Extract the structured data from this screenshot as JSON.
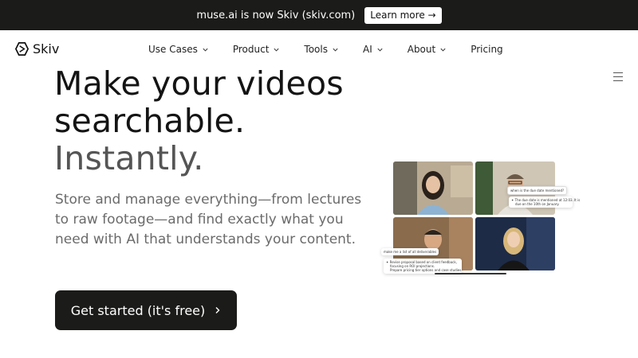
{
  "announcement": {
    "text": "muse.ai is now Skiv (skiv.com)",
    "button_label": "Learn more →"
  },
  "nav": {
    "logo_text": "Skiv",
    "items": [
      {
        "label": "Use Cases",
        "has_dropdown": true
      },
      {
        "label": "Product",
        "has_dropdown": true
      },
      {
        "label": "Tools",
        "has_dropdown": true
      },
      {
        "label": "AI",
        "has_dropdown": true
      },
      {
        "label": "About",
        "has_dropdown": true
      },
      {
        "label": "Pricing",
        "has_dropdown": false
      }
    ]
  },
  "hero": {
    "title_line1": "Make your videos",
    "title_line2": "searchable.",
    "title_line3": "Instantly.",
    "subtitle": "Store and manage everything—from lectures to raw footage—and find exactly what you need with AI that understands your content.",
    "cta_label": "Get started (it's free)"
  },
  "illustration": {
    "question_bubble": "when is the due date mentioned?",
    "answer_line1": "The due date is mentioned at 12:03. It is",
    "answer_line2": "due on the 10th on January.",
    "prompt_bubble": "make me a list of all deliverables",
    "list_item1_line1": "Revise proposal based on client feedback,",
    "list_item1_line2": "focusing on ROI projections.",
    "list_item2": "Prepare pricing tier options and case studies."
  },
  "colors": {
    "dark": "#1b1b19",
    "accent_blue": "#3b82f6"
  }
}
